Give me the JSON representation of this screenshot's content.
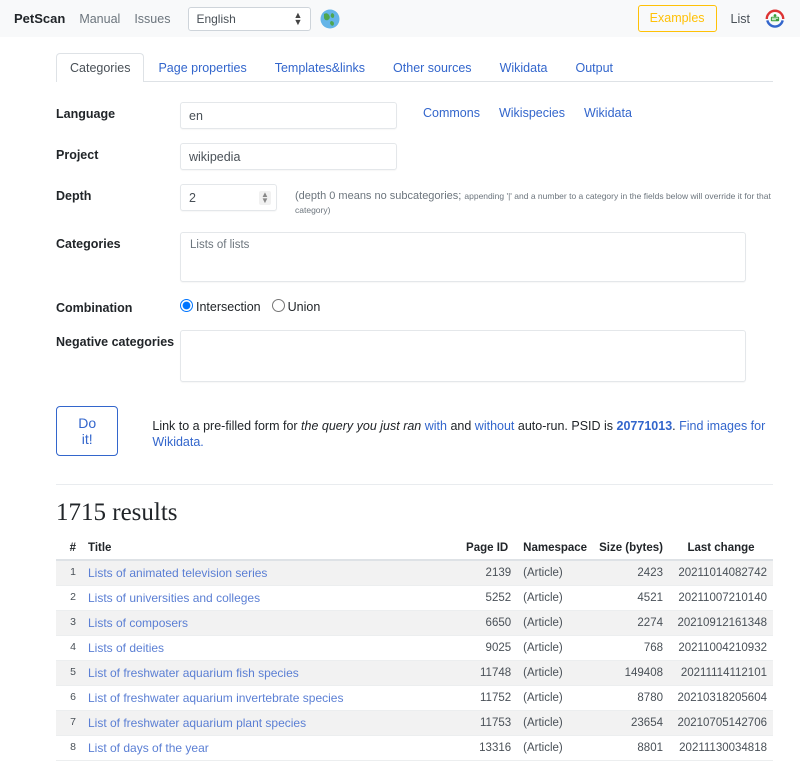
{
  "navbar": {
    "brand": "PetScan",
    "links": [
      {
        "label": "Manual"
      },
      {
        "label": "Issues"
      }
    ],
    "language_select": {
      "value": "English",
      "options": [
        "English"
      ]
    },
    "globe_icon": "globe-icon",
    "examples_label": "Examples",
    "list_label": "List",
    "logo_icon": "wikidata-logo-icon"
  },
  "tabs": [
    {
      "label": "Categories",
      "active": true
    },
    {
      "label": "Page properties",
      "active": false
    },
    {
      "label": "Templates&links",
      "active": false
    },
    {
      "label": "Other sources",
      "active": false
    },
    {
      "label": "Wikidata",
      "active": false
    },
    {
      "label": "Output",
      "active": false
    }
  ],
  "form": {
    "language": {
      "label": "Language",
      "value": "en"
    },
    "project": {
      "label": "Project",
      "value": "wikipedia"
    },
    "depth": {
      "label": "Depth",
      "value": "2",
      "hint_main": "(depth 0 means no subcategories;",
      "hint_small": "appending '|' and a number to a category in the fields below will override it for that category)"
    },
    "categories": {
      "label": "Categories",
      "value": "Lists of lists"
    },
    "combination": {
      "label": "Combination",
      "options": [
        {
          "label": "Intersection",
          "checked": true
        },
        {
          "label": "Union",
          "checked": false
        }
      ]
    },
    "negative_categories": {
      "label": "Negative categories",
      "value": ""
    },
    "project_links": [
      {
        "label": "Commons"
      },
      {
        "label": "Wikispecies"
      },
      {
        "label": "Wikidata"
      }
    ]
  },
  "actions": {
    "do_it_label": "Do it!",
    "link_text_1": "Link to a pre-filled form for ",
    "link_text_em": "the query you just ran",
    "link_with": "with",
    "link_text_2": " and ",
    "link_without": "without",
    "link_text_3": " auto-run. PSID is ",
    "psid": "20771013",
    "link_text_4": ". ",
    "find_images": "Find images for Wikidata."
  },
  "results": {
    "title": "1715 results",
    "columns": {
      "num": "#",
      "title": "Title",
      "page_id": "Page ID",
      "namespace": "Namespace",
      "size": "Size (bytes)",
      "last_change": "Last change"
    },
    "rows": [
      {
        "num": "1",
        "title": "Lists of animated television series",
        "page_id": "2139",
        "namespace": "(Article)",
        "size": "2423",
        "last_change": "20211014082742"
      },
      {
        "num": "2",
        "title": "Lists of universities and colleges",
        "page_id": "5252",
        "namespace": "(Article)",
        "size": "4521",
        "last_change": "20211007210140"
      },
      {
        "num": "3",
        "title": "Lists of composers",
        "page_id": "6650",
        "namespace": "(Article)",
        "size": "2274",
        "last_change": "20210912161348"
      },
      {
        "num": "4",
        "title": "Lists of deities",
        "page_id": "9025",
        "namespace": "(Article)",
        "size": "768",
        "last_change": "20211004210932"
      },
      {
        "num": "5",
        "title": "List of freshwater aquarium fish species",
        "page_id": "11748",
        "namespace": "(Article)",
        "size": "149408",
        "last_change": "20211114112101"
      },
      {
        "num": "6",
        "title": "List of freshwater aquarium invertebrate species",
        "page_id": "11752",
        "namespace": "(Article)",
        "size": "8780",
        "last_change": "20210318205604"
      },
      {
        "num": "7",
        "title": "List of freshwater aquarium plant species",
        "page_id": "11753",
        "namespace": "(Article)",
        "size": "23654",
        "last_change": "20210705142706"
      },
      {
        "num": "8",
        "title": "List of days of the year",
        "page_id": "13316",
        "namespace": "(Article)",
        "size": "8801",
        "last_change": "20211130034818"
      }
    ]
  },
  "colors": {
    "link": "#3366cc",
    "accent_warning": "#ffc107",
    "navbar_bg": "#f8f9fa"
  }
}
